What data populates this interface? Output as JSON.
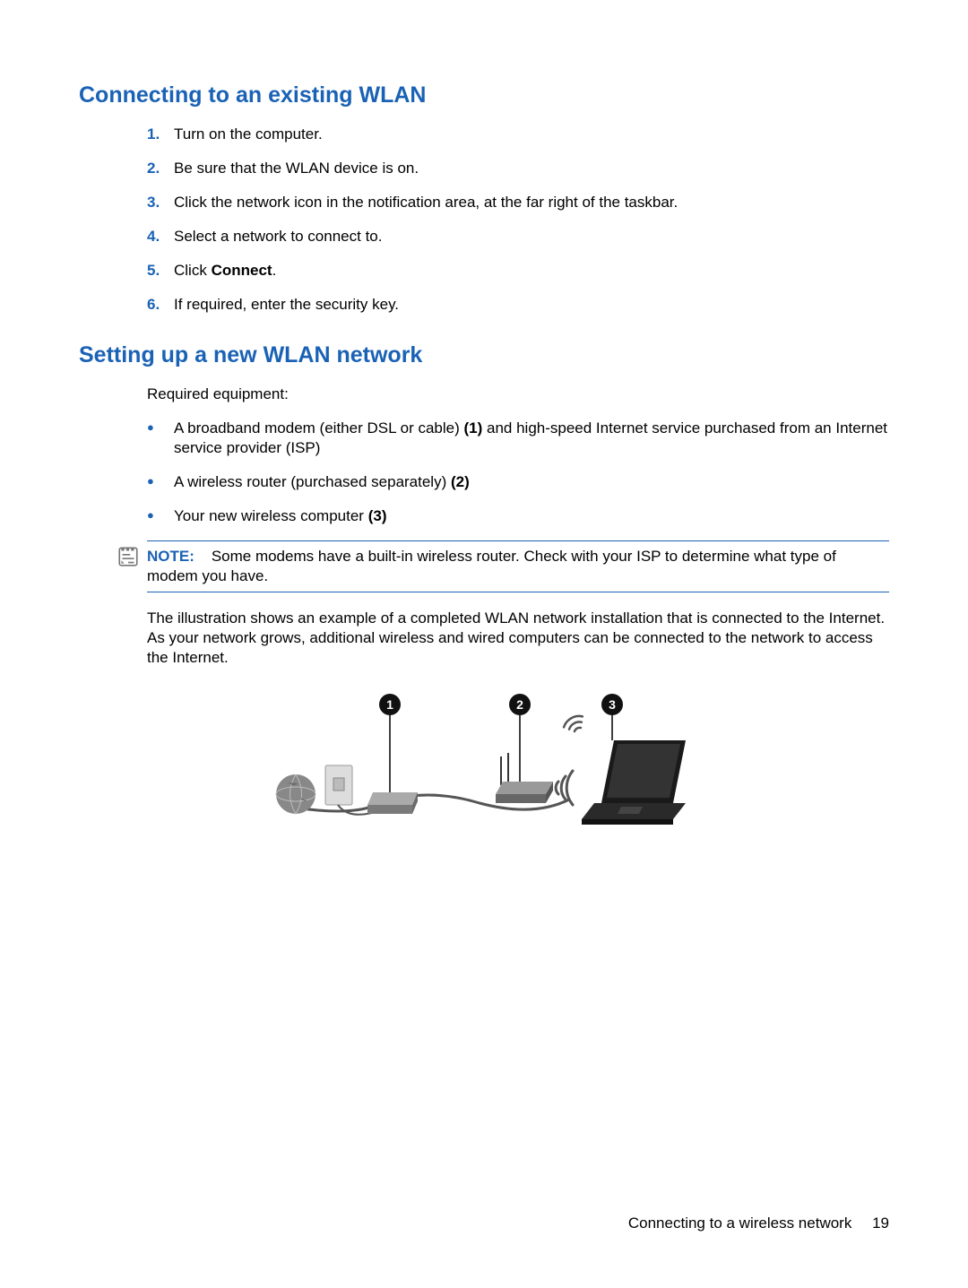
{
  "section1": {
    "heading": "Connecting to an existing WLAN",
    "steps": [
      {
        "num": "1.",
        "text": "Turn on the computer."
      },
      {
        "num": "2.",
        "text": "Be sure that the WLAN device is on."
      },
      {
        "num": "3.",
        "text": "Click the network icon in the notification area, at the far right of the taskbar."
      },
      {
        "num": "4.",
        "text": "Select a network to connect to."
      },
      {
        "num": "5.",
        "prefix": "Click ",
        "bold": "Connect",
        "suffix": "."
      },
      {
        "num": "6.",
        "text": "If required, enter the security key."
      }
    ]
  },
  "section2": {
    "heading": "Setting up a new WLAN network",
    "intro": "Required equipment:",
    "bullets": [
      {
        "prefix": "A broadband modem (either DSL or cable) ",
        "bold": "(1)",
        "suffix": " and high-speed Internet service purchased from an Internet service provider (ISP)"
      },
      {
        "prefix": "A wireless router (purchased separately) ",
        "bold": "(2)",
        "suffix": ""
      },
      {
        "prefix": "Your new wireless computer ",
        "bold": "(3)",
        "suffix": ""
      }
    ],
    "note": {
      "label": "NOTE:",
      "text": "Some modems have a built-in wireless router. Check with your ISP to determine what type of modem you have."
    },
    "after_note": "The illustration shows an example of a completed WLAN network installation that is connected to the Internet. As your network grows, additional wireless and wired computers can be connected to the network to access the Internet.",
    "callouts": {
      "c1": "1",
      "c2": "2",
      "c3": "3"
    }
  },
  "footer": {
    "text": "Connecting to a wireless network",
    "page": "19"
  }
}
